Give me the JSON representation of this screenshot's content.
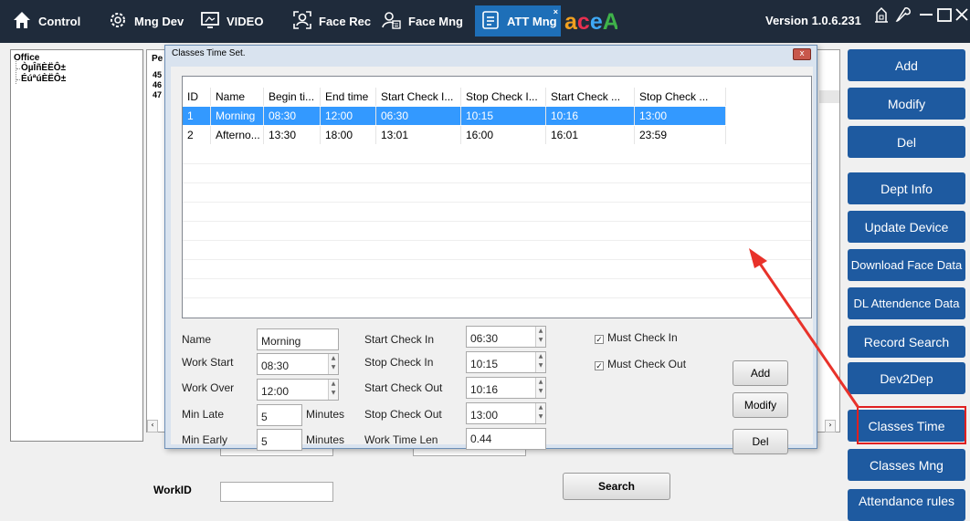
{
  "topbar": {
    "tabs": [
      {
        "label": "Control",
        "icon": "home-icon"
      },
      {
        "label": "Mng Dev",
        "icon": "device-gear-icon"
      },
      {
        "label": "VIDEO",
        "icon": "video-icon"
      },
      {
        "label": "Face Rec",
        "icon": "face-scan-icon"
      },
      {
        "label": "Face Mng",
        "icon": "user-manage-icon"
      },
      {
        "label": "ATT Mng",
        "icon": "attendance-icon"
      }
    ],
    "brand": "aceAI",
    "version": "Version 1.0.6.231",
    "window_controls": [
      "⌂",
      "⚙",
      "—",
      "□",
      "✕"
    ]
  },
  "sidebar": {
    "buttons": [
      "Add",
      "Modify",
      "Del",
      "Dept Info",
      "Update Device",
      "Download Face Data",
      "DL Attendence Data",
      "Record Search",
      "Dev2Dep",
      "Classes Time",
      "Classes Mng",
      "Attendance rules"
    ]
  },
  "tree": {
    "root": "Office",
    "children": [
      "ÒµÎñÈËÔ±",
      "ÉúªúÈËÔ±"
    ]
  },
  "background": {
    "col_header": "Pe",
    "rows": [
      "45",
      "46",
      "47"
    ],
    "workid_label": "WorkID",
    "search_label": "Search"
  },
  "dialog": {
    "title": "Classes Time Set.",
    "close": "x",
    "columns": [
      "ID",
      "Name",
      "Begin ti...",
      "End time",
      "Start Check I...",
      "Stop Check I...",
      "Start Check ...",
      "Stop Check ..."
    ],
    "rows": [
      [
        "1",
        "Morning",
        "08:30",
        "12:00",
        "06:30",
        "10:15",
        "10:16",
        "13:00"
      ],
      [
        "2",
        "Afterno...",
        "13:30",
        "18:00",
        "13:01",
        "16:00",
        "16:01",
        "23:59"
      ]
    ],
    "form": {
      "name_label": "Name",
      "name_value": "Morning",
      "work_start_label": "Work Start",
      "work_start_value": "08:30",
      "work_over_label": "Work Over",
      "work_over_value": "12:00",
      "min_late_label": "Min Late",
      "min_late_value": "5",
      "min_late_unit": "Minutes",
      "min_early_label": "Min Early",
      "min_early_value": "5",
      "min_early_unit": "Minutes",
      "start_check_in_label": "Start Check In",
      "start_check_in_value": "06:30",
      "stop_check_in_label": "Stop Check In",
      "stop_check_in_value": "10:15",
      "start_check_out_label": "Start Check Out",
      "start_check_out_value": "10:16",
      "stop_check_out_label": "Stop Check Out",
      "stop_check_out_value": "13:00",
      "work_time_len_label": "Work Time Len",
      "work_time_len_value": "0.44",
      "must_check_in": "Must Check In",
      "must_check_out": "Must Check Out"
    },
    "buttons": {
      "add": "Add",
      "modify": "Modify",
      "del": "Del"
    }
  },
  "colors": {
    "topbar": "#1f2b3b",
    "active_tab": "#1e6fb8",
    "side_button": "#1e5aa0",
    "highlight_box": "#e02020",
    "arrow": "#e8322a",
    "selection": "#3399ff"
  }
}
